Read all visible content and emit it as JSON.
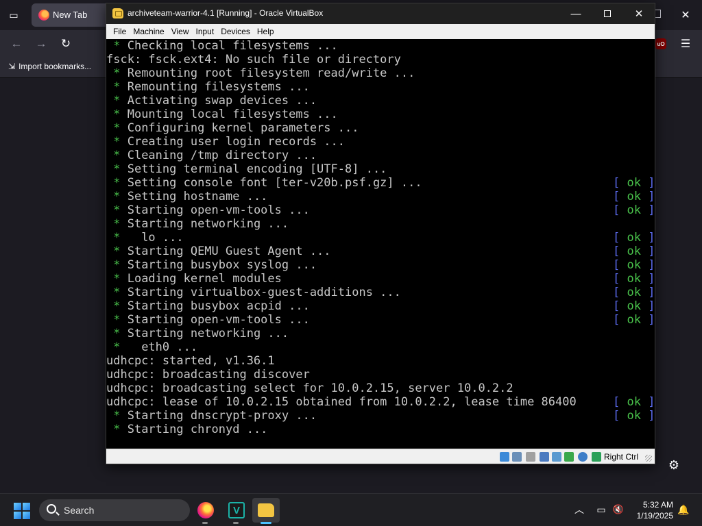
{
  "browser": {
    "tab_title": "New Tab",
    "import_bookmarks_label": "Import bookmarks..."
  },
  "vbox": {
    "title": "archiveteam-warrior-4.1 [Running] - Oracle VirtualBox",
    "menus": [
      "File",
      "Machine",
      "View",
      "Input",
      "Devices",
      "Help"
    ],
    "host_key": "Right Ctrl",
    "ok_bracket_open": "[ ",
    "ok_word": "ok",
    "ok_bracket_close": " ]",
    "console_lines": [
      {
        "star": true,
        "text": "Checking local filesystems ...",
        "ok": false
      },
      {
        "star": false,
        "text": "fsck: fsck.ext4: No such file or directory",
        "ok": false
      },
      {
        "star": true,
        "text": "Remounting root filesystem read/write ...",
        "ok": false
      },
      {
        "star": true,
        "text": "Remounting filesystems ...",
        "ok": false
      },
      {
        "star": true,
        "text": "Activating swap devices ...",
        "ok": false
      },
      {
        "star": true,
        "text": "Mounting local filesystems ...",
        "ok": false
      },
      {
        "star": true,
        "text": "Configuring kernel parameters ...",
        "ok": false
      },
      {
        "star": true,
        "text": "Creating user login records ...",
        "ok": false
      },
      {
        "star": true,
        "text": "Cleaning /tmp directory ...",
        "ok": false
      },
      {
        "star": true,
        "text": "Setting terminal encoding [UTF-8] ...",
        "ok": false
      },
      {
        "star": true,
        "text": "Setting console font [ter-v20b.psf.gz] ...",
        "ok": true
      },
      {
        "star": true,
        "text": "Setting hostname ...",
        "ok": true
      },
      {
        "star": true,
        "text": "Starting open-vm-tools ...",
        "ok": true
      },
      {
        "star": true,
        "text": "Starting networking ...",
        "ok": false
      },
      {
        "star": true,
        "text": "  lo ...",
        "ok": true
      },
      {
        "star": true,
        "text": "Starting QEMU Guest Agent ...",
        "ok": true
      },
      {
        "star": true,
        "text": "Starting busybox syslog ...",
        "ok": true
      },
      {
        "star": true,
        "text": "Loading kernel modules",
        "ok": true
      },
      {
        "star": true,
        "text": "Starting virtualbox-guest-additions ...",
        "ok": true
      },
      {
        "star": true,
        "text": "Starting busybox acpid ...",
        "ok": true
      },
      {
        "star": true,
        "text": "Starting open-vm-tools ...",
        "ok": true
      },
      {
        "star": true,
        "text": "Starting networking ...",
        "ok": false
      },
      {
        "star": true,
        "text": "  eth0 ...",
        "ok": false
      },
      {
        "star": false,
        "text": "udhcpc: started, v1.36.1",
        "ok": false
      },
      {
        "star": false,
        "text": "udhcpc: broadcasting discover",
        "ok": false
      },
      {
        "star": false,
        "text": "udhcpc: broadcasting select for 10.0.2.15, server 10.0.2.2",
        "ok": false
      },
      {
        "star": false,
        "text": "udhcpc: lease of 10.0.2.15 obtained from 10.0.2.2, lease time 86400",
        "ok": true
      },
      {
        "star": true,
        "text": "Starting dnscrypt-proxy ...",
        "ok": true
      },
      {
        "star": true,
        "text": "Starting chronyd ...",
        "ok": false
      }
    ]
  },
  "taskbar": {
    "search_label": "Search",
    "time": "5:32 AM",
    "date": "1/19/2025"
  },
  "colors": {
    "console_star": "#49c14b",
    "console_bracket": "#5c6cf0",
    "console_text": "#c8c8c8"
  }
}
